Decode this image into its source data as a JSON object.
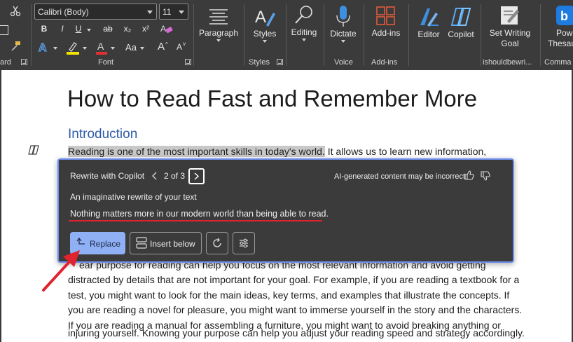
{
  "ribbon": {
    "clipboard_label": "ard",
    "font_name": "Calibri (Body)",
    "font_size": "11",
    "font_group_label": "Font",
    "paragraph_label": "Paragraph",
    "styles_label": "Styles",
    "styles_group_label": "Styles",
    "editing_label": "Editing",
    "dictate_label": "Dictate",
    "voice_group_label": "Voice",
    "addins_label": "Add-ins",
    "addins_group_label": "Add-ins",
    "editor_label": "Editor",
    "copilot_label": "Copilot",
    "set_goal_line1": "Set Writing",
    "set_goal_line2": "Goal",
    "ishould_group_label": "ishouldbewri...",
    "powerthes_line1": "Powe",
    "powerthes_line2": "Thesau",
    "commands_group_label": "Comma",
    "bold": "B",
    "italic": "I",
    "underline": "U",
    "strike": "ab",
    "subscript": "x₂",
    "superscript": "x²",
    "text_effects": "A",
    "highlight": "ab",
    "font_color": "A",
    "change_case": "Aa",
    "grow_font": "A",
    "shrink_font": "A"
  },
  "document": {
    "title": "How to Read Fast and Remember More",
    "heading": "Introduction",
    "line1_selected": "Reading is one of the most important skills in today's world.",
    "line1_rest": " It allows us to learn new information,",
    "lines": [
      "ear purpose for reading can help you focus on the most relevant information and avoid getting",
      "distracted by details that are not important for your goal. For example, if you are reading a textbook for a",
      "test, you might want to look for the main ideas, key terms, and examples that illustrate the concepts. If",
      "you are reading a novel for pleasure, you might want to immerse yourself in the story and the characters.",
      "If you are reading a manual for assembling a furniture, you might want to avoid breaking anything or",
      "injuring yourself. Knowing your purpose can help you adjust your reading speed and strategy accordingly."
    ]
  },
  "copilot": {
    "title": "Rewrite with Copilot",
    "counter": "2 of 3",
    "disclaimer": "AI-generated content may be incorrect",
    "subtitle": "An imaginative rewrite of your text",
    "rewrite": "Nothing matters more in our modern world than being able to read.",
    "replace_label": "Replace",
    "insert_below_label": "Insert below"
  },
  "colors": {
    "panel_border": "#6f8ff0",
    "replace_bg": "#8fb0f5",
    "annotation_red": "#e0232e",
    "heading_blue": "#2e5aa8"
  }
}
